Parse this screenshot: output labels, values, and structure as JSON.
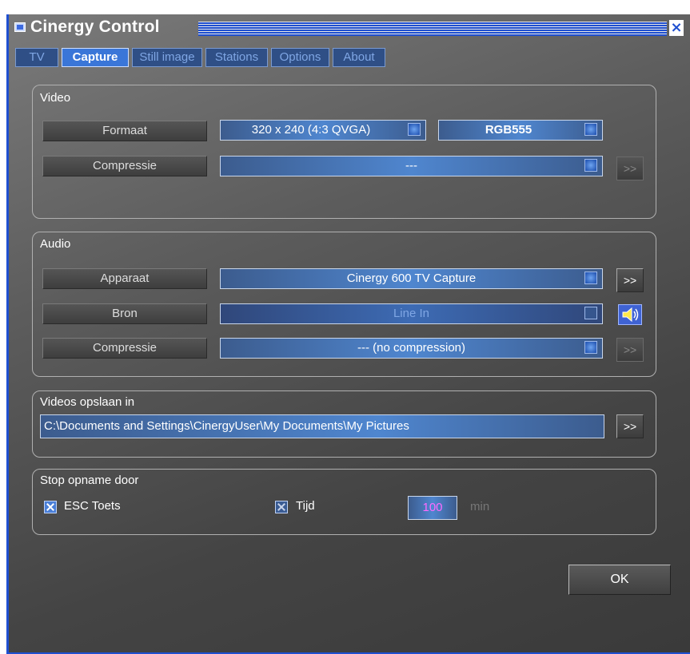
{
  "window": {
    "title": "Cinergy Control",
    "close_glyph": "×"
  },
  "tabs": [
    {
      "label": "TV",
      "active": false
    },
    {
      "label": "Capture",
      "active": true
    },
    {
      "label": "Still image",
      "active": false
    },
    {
      "label": "Stations",
      "active": false
    },
    {
      "label": "Options",
      "active": false
    },
    {
      "label": "About",
      "active": false
    }
  ],
  "video": {
    "group_label": "Video",
    "format_label": "Formaat",
    "format_value": "320 x 240 (4:3 QVGA)",
    "color_value": "RGB555",
    "compression_label": "Compressie",
    "compression_value": "---",
    "more_label": ">>"
  },
  "audio": {
    "group_label": "Audio",
    "device_label": "Apparaat",
    "device_value": "Cinergy 600 TV Capture",
    "source_label": "Bron",
    "source_value": "Line In",
    "compression_label": "Compressie",
    "compression_value": "--- (no compression)",
    "more_label": ">>",
    "speaker_icon": "speaker-icon"
  },
  "save": {
    "group_label": "Videos opslaan in",
    "path": "C:\\Documents and Settings\\CinergyUser\\My Documents\\My Pictures",
    "browse_label": ">>"
  },
  "stop": {
    "group_label": "Stop opname door",
    "esc_label": "ESC Toets",
    "esc_checked": true,
    "time_label": "Tijd",
    "time_checked": true,
    "minutes": "100",
    "unit": "min"
  },
  "ok_label": "OK",
  "colors": {
    "titlebar": "#1f4fd0",
    "accent": "#4f86cf"
  }
}
